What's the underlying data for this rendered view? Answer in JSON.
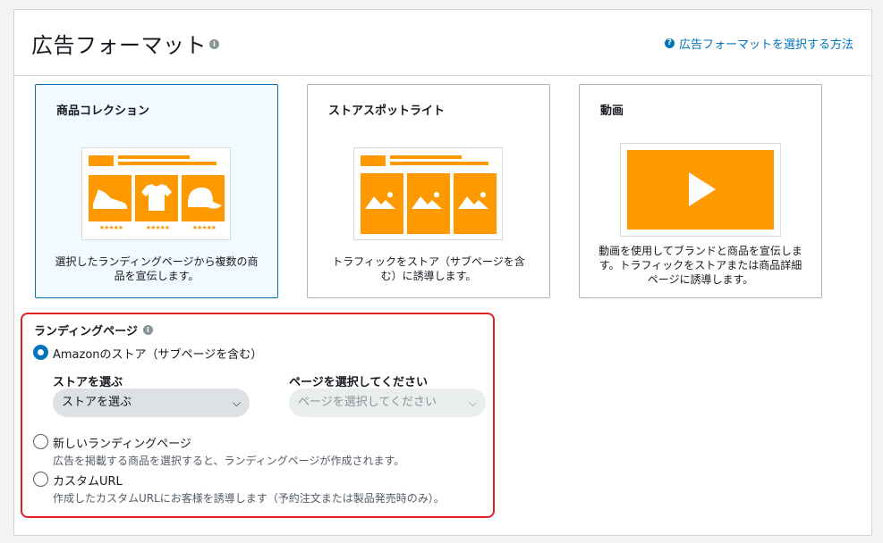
{
  "header": {
    "title": "広告フォーマット",
    "info_icon": "i",
    "help_icon": "?",
    "help_link": "広告フォーマットを選択する方法"
  },
  "cards": [
    {
      "title": "商品コレクション",
      "desc_line1": "選択したランディングページから複数の商",
      "desc_line2": "品を宣伝します。",
      "ratings": [
        "★★★★★",
        "★★★★★",
        "★★★★★"
      ]
    },
    {
      "title": "ストアスポットライト",
      "desc_line1": "トラフィックをストア（サブページを含",
      "desc_line2": "む）に誘導します。"
    },
    {
      "title": "動画",
      "desc_line1": "動画を使用してブランドと商品を宣伝しま",
      "desc_line2": "す。トラフィックをストアまたは商品詳細",
      "desc_line3": "ページに誘導します。"
    }
  ],
  "landing": {
    "label": "ランディングページ",
    "info_icon": "i",
    "options": [
      {
        "label": "Amazonのストア（サブページを含む）"
      },
      {
        "label": "新しいランディングページ",
        "desc": "広告を掲載する商品を選択すると、ランディングページが作成されます。"
      },
      {
        "label": "カスタムURL",
        "desc": "作成したカスタムURLにお客様を誘導します（予約注文または製品発売時のみ）。"
      }
    ],
    "store_label": "ストアを選ぶ",
    "store_value": "ストアを選ぶ",
    "page_label": "ページを選択してください",
    "page_value": "ページを選択してください"
  },
  "colors": {
    "accent": "#0073bb",
    "orange": "#ff9900",
    "highlight": "#e02020"
  }
}
